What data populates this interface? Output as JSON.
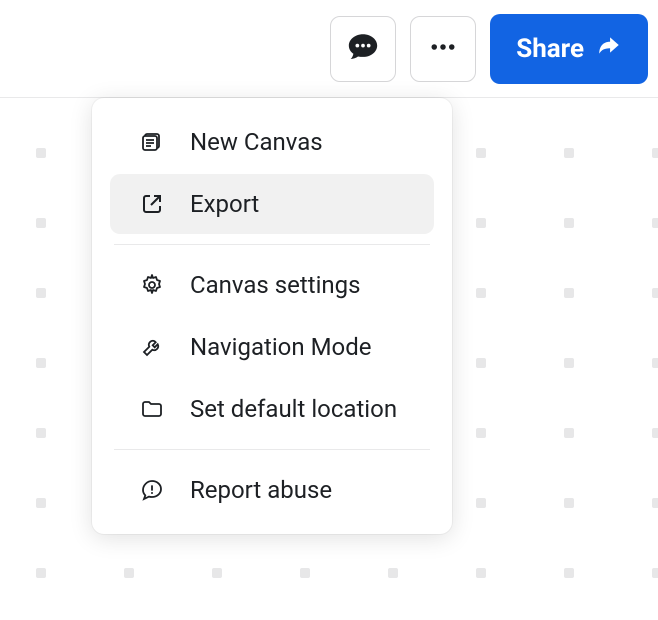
{
  "topbar": {
    "share_label": "Share"
  },
  "menu": {
    "items": [
      {
        "label": "New Canvas"
      },
      {
        "label": "Export"
      },
      {
        "label": "Canvas settings"
      },
      {
        "label": "Navigation Mode"
      },
      {
        "label": "Set default location"
      },
      {
        "label": "Report abuse"
      }
    ]
  }
}
